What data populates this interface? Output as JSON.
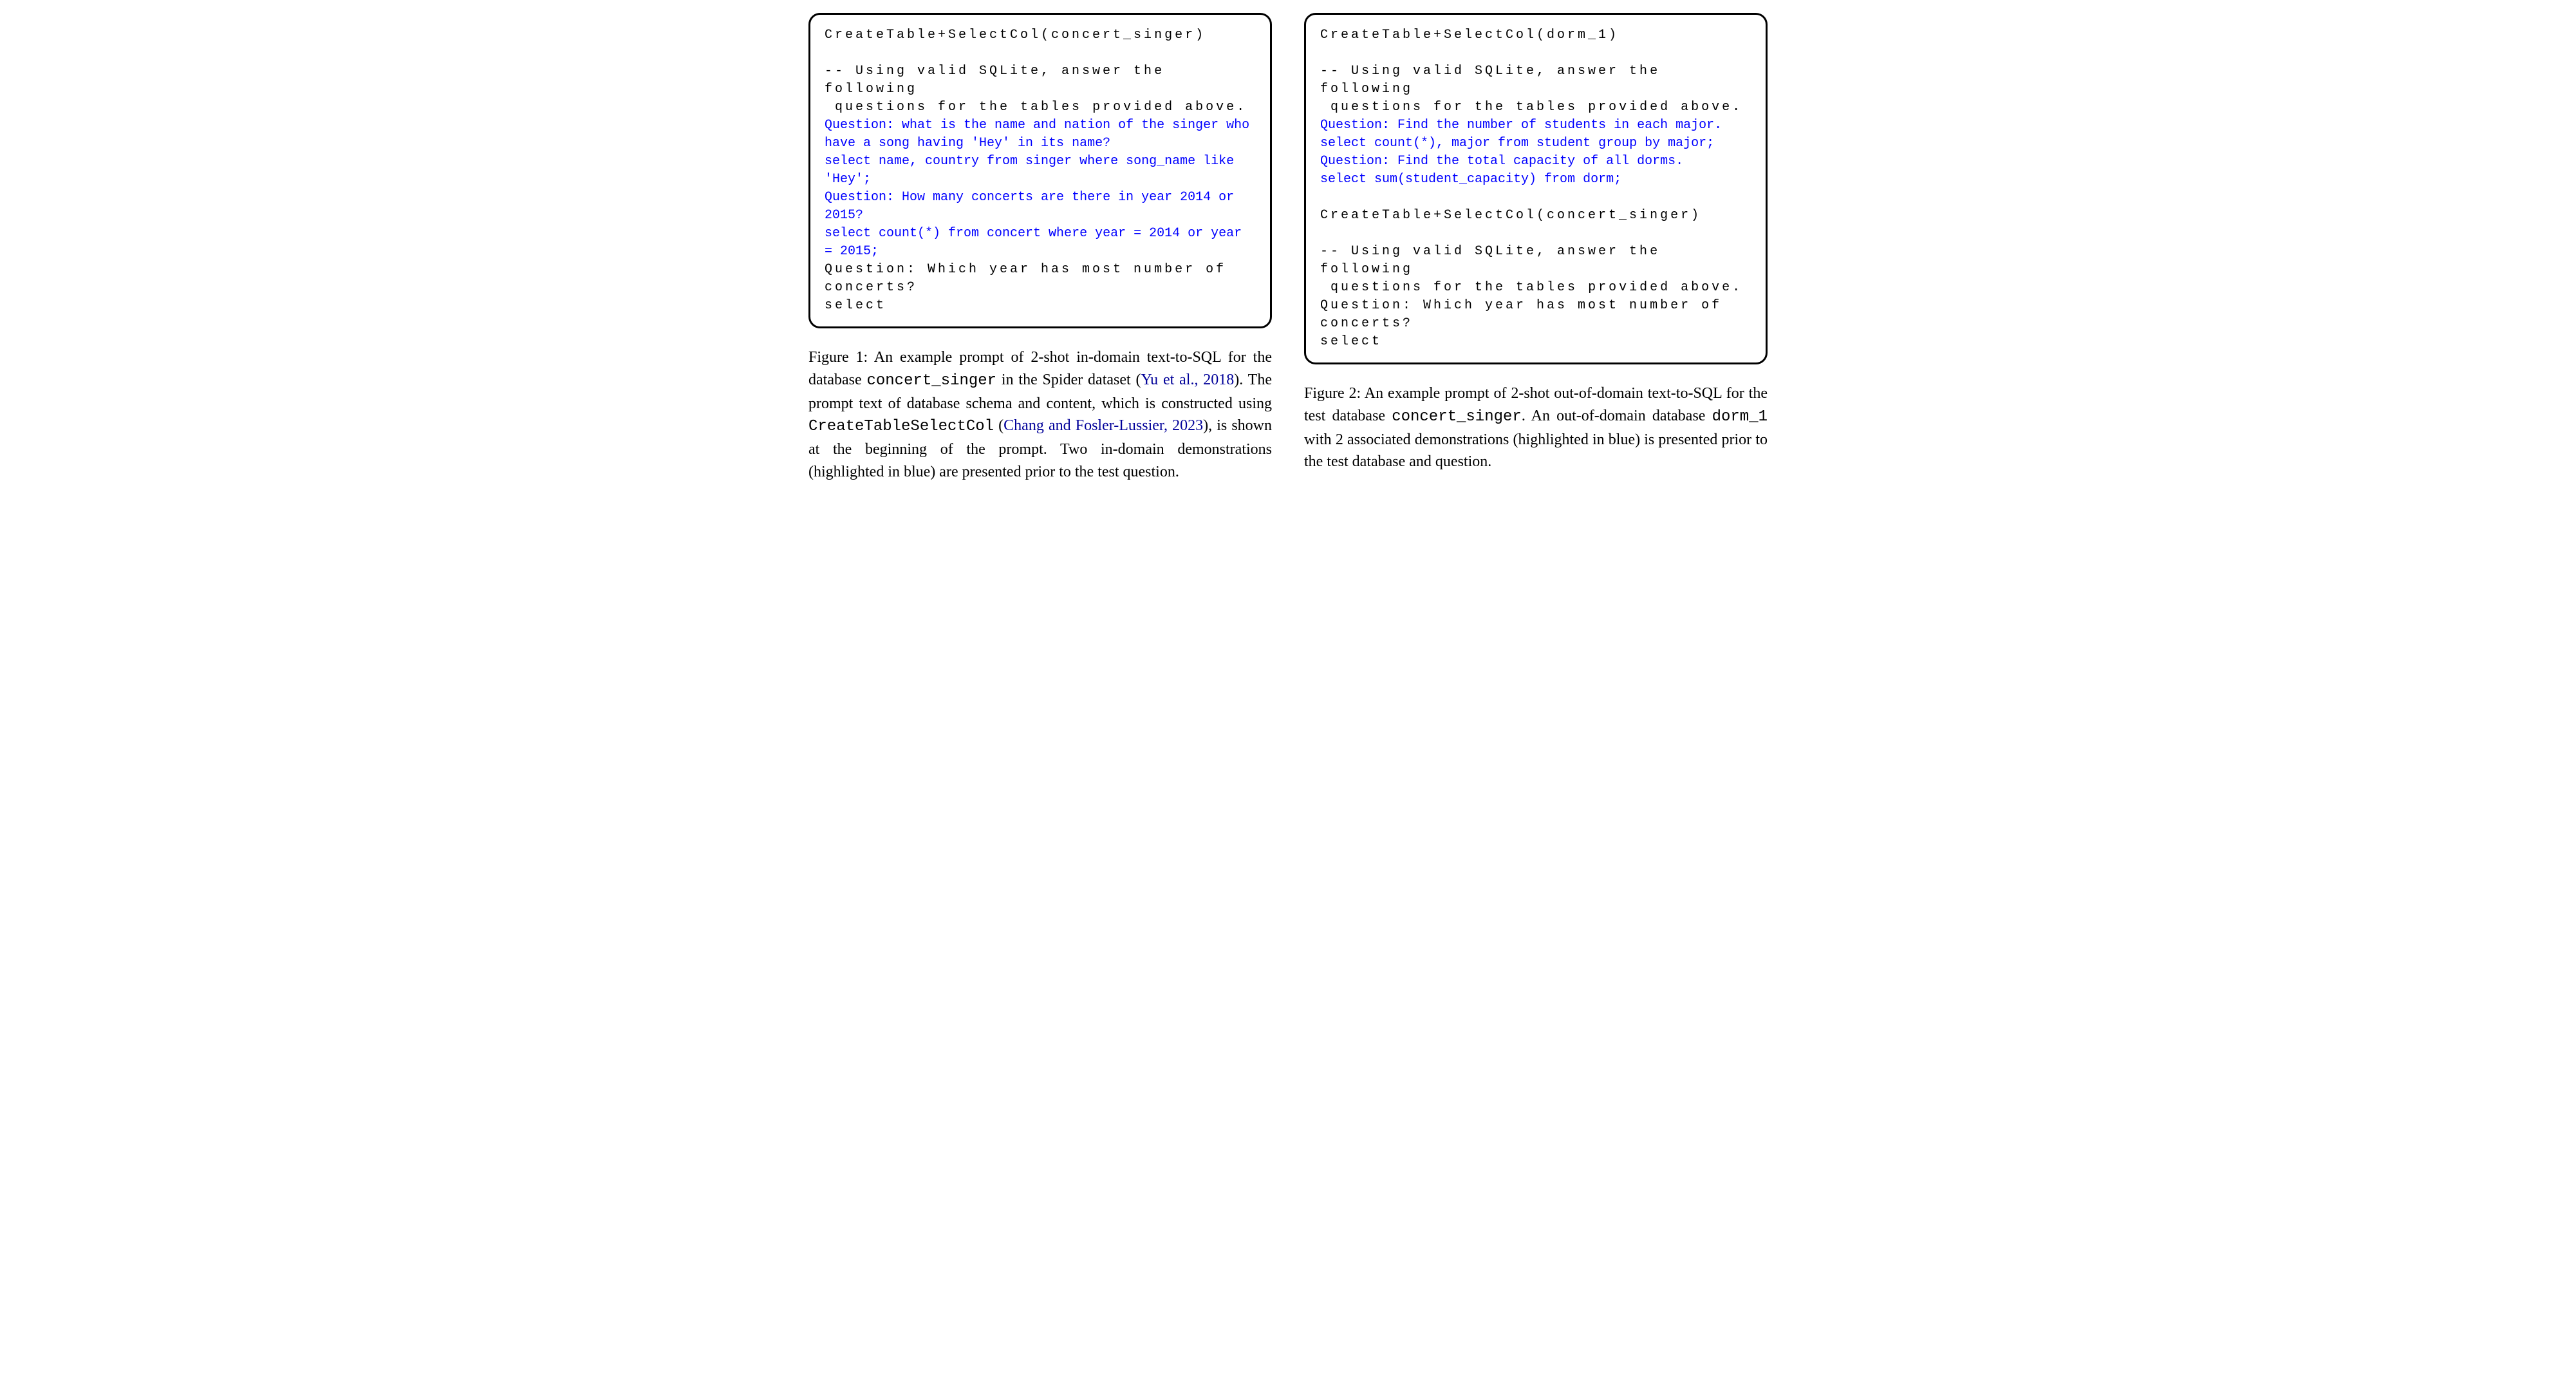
{
  "figure1": {
    "code": {
      "line1": "CreateTable+SelectCol(concert_singer)",
      "line2": "-- Using valid SQLite, answer the following\n questions for the tables provided above.",
      "blue1": "Question: what is the name and nation of the singer who have a song having 'Hey' in its name?\nselect name, country from singer where song_name like 'Hey';\nQuestion: How many concerts are there in year 2014 or 2015?\nselect count(*) from concert where year = 2014 or year = 2015;",
      "line3": "Question: Which year has most number of concerts?\nselect"
    },
    "caption": {
      "label": "Figure 1:",
      "part1": " An example prompt of 2-shot in-domain text-to-SQL for the database ",
      "mono1": "concert_singer",
      "part2": " in the Spider dataset (",
      "cite1": "Yu et al., 2018",
      "part3": "). The prompt text of database schema and content, which is constructed using ",
      "mono2": "CreateTableSelectCol",
      "part4": " (",
      "cite2": "Chang and Fosler-Lussier, 2023",
      "part5": "), is shown at the beginning of the prompt. Two in-domain demonstrations (highlighted in blue) are presented prior to the test question."
    }
  },
  "figure2": {
    "code": {
      "line1": "CreateTable+SelectCol(dorm_1)",
      "line2": "-- Using valid SQLite, answer the following\n questions for the tables provided above.",
      "blue1": "Question: Find the number of students in each major.\nselect count(*), major from student group by major;\nQuestion: Find the total capacity of all dorms.\nselect sum(student_capacity) from dorm;",
      "line3": "CreateTable+SelectCol(concert_singer)",
      "line4": "-- Using valid SQLite, answer the following\n questions for the tables provided above.\nQuestion: Which year has most number of concerts?\nselect"
    },
    "caption": {
      "label": "Figure 2:",
      "part1": " An example prompt of 2-shot out-of-domain text-to-SQL for the test database ",
      "mono1": "concert_singer",
      "part2": ". An out-of-domain database ",
      "mono2": "dorm_1",
      "part3": " with 2 associated demonstrations (highlighted in blue) is presented prior to the test database and question."
    }
  }
}
